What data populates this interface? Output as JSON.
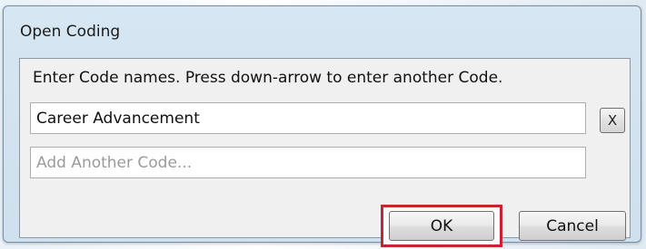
{
  "dialog": {
    "title": "Open Coding",
    "instructions": "Enter Code names. Press down-arrow to enter another Code.",
    "codes": [
      {
        "value": "Career Advancement",
        "placeholder": ""
      },
      {
        "value": "",
        "placeholder": "Add Another Code..."
      }
    ],
    "remove_label": "X",
    "ok_label": "OK",
    "cancel_label": "Cancel"
  },
  "colors": {
    "highlight": "#c8242c",
    "frame": "#d6e6f2",
    "client": "#f0f0f0"
  }
}
